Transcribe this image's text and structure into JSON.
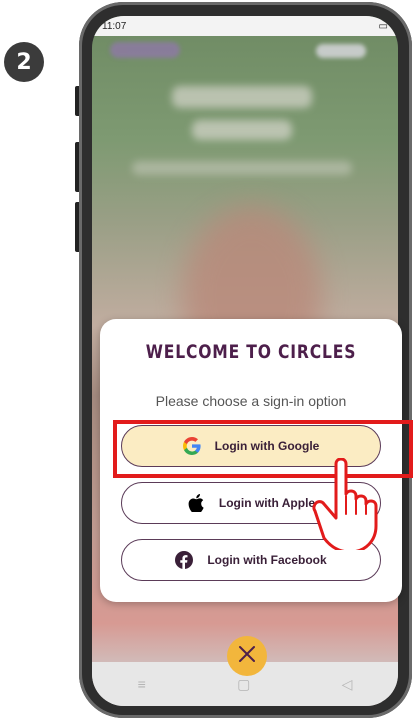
{
  "step_badge": "2",
  "status_bar": {
    "time": "11:07"
  },
  "modal": {
    "title": "WELCOME TO CIRCLES",
    "subtitle": "Please choose a sign-in option",
    "buttons": [
      {
        "label": "Login with Google",
        "icon": "google-icon"
      },
      {
        "label": "Login with Apple",
        "icon": "apple-icon"
      },
      {
        "label": "Login with Facebook",
        "icon": "facebook-icon"
      }
    ]
  },
  "colors": {
    "title": "#4d1f4b",
    "google_button_bg": "#fbecc3",
    "highlight": "#e21b1b",
    "close_button": "#f2b63c",
    "facebook": "#3a2038"
  }
}
